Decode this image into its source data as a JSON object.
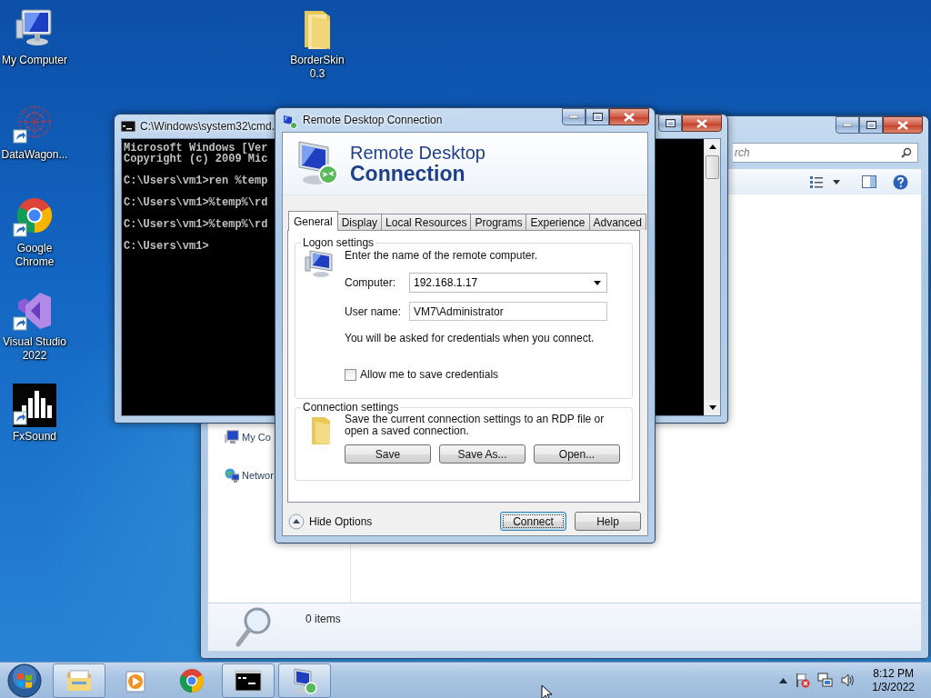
{
  "desktop_icons": [
    {
      "label": "My Computer",
      "kind": "computer",
      "shortcut": false
    },
    {
      "label": "BorderSkin 0.3",
      "kind": "folder",
      "shortcut": false
    },
    {
      "label": "DataWagon...",
      "kind": "molecule",
      "shortcut": true
    },
    {
      "label": "Google Chrome",
      "kind": "browser",
      "shortcut": true
    },
    {
      "label": "Visual Studio 2022",
      "kind": "ide",
      "shortcut": true
    },
    {
      "label": "FxSound",
      "kind": "equalizer",
      "shortcut": true
    }
  ],
  "explorer": {
    "search": {
      "placeholder": "rch"
    },
    "nav_items": [
      {
        "label": "My Co",
        "kind": "computer"
      },
      {
        "label": "Networ",
        "kind": "network"
      }
    ],
    "status": "0 items"
  },
  "cmd": {
    "title": "C:\\Windows\\system32\\cmd.",
    "blocks": [
      [
        "Microsoft Windows [Ver",
        "Copyright (c) 2009 Mic"
      ],
      [
        "C:\\Users\\vm1>ren %temp"
      ],
      [
        "C:\\Users\\vm1>%temp%\\rd"
      ],
      [
        "C:\\Users\\vm1>%temp%\\rd"
      ],
      [
        "C:\\Users\\vm1>"
      ]
    ]
  },
  "rdc": {
    "title": "Remote Desktop Connection",
    "heading_line1": "Remote Desktop",
    "heading_line2": "Connection",
    "tabs": [
      {
        "label": "General",
        "selected": true
      },
      {
        "label": "Display",
        "selected": false
      },
      {
        "label": "Local Resources",
        "selected": false
      },
      {
        "label": "Programs",
        "selected": false
      },
      {
        "label": "Experience",
        "selected": false
      },
      {
        "label": "Advanced",
        "selected": false
      }
    ],
    "logon": {
      "legend": "Logon settings",
      "prompt": "Enter the name of the remote computer.",
      "computer_label": "Computer:",
      "computer_value": "192.168.1.17",
      "username_label": "User name:",
      "username_value": "VM7\\Administrator",
      "note": "You will be asked for credentials when you connect.",
      "save_credentials": {
        "label": "Allow me to save credentials",
        "checked": false
      }
    },
    "connection": {
      "legend": "Connection settings",
      "text": "Save the current connection settings to an RDP file or open a saved connection.",
      "buttons": [
        "Save",
        "Save As...",
        "Open..."
      ]
    },
    "options_toggle": "Hide Options",
    "buttons": [
      {
        "label": "Connect",
        "default": true
      },
      {
        "label": "Help",
        "default": false
      }
    ]
  },
  "taskbar": {
    "items": [
      {
        "kind": "explorer",
        "running": true
      },
      {
        "kind": "media",
        "running": false
      },
      {
        "kind": "browser",
        "running": false
      },
      {
        "kind": "console",
        "running": true
      },
      {
        "kind": "remote",
        "running": true
      }
    ],
    "clock": {
      "time": "8:12 PM",
      "date": "1/3/2022"
    }
  }
}
